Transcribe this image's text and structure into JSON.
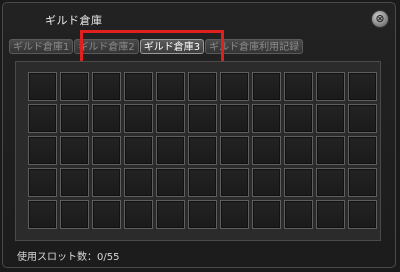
{
  "window": {
    "title": "ギルド倉庫",
    "close_symbol": "⊗"
  },
  "tabs": [
    {
      "label": "ギルド倉庫1",
      "active": false
    },
    {
      "label": "ギルド倉庫2",
      "active": false
    },
    {
      "label": "ギルド倉庫3",
      "active": true
    },
    {
      "label": "ギルド倉庫利用記録",
      "active": false
    }
  ],
  "highlight_color": "#e01f1f",
  "grid": {
    "columns": 11,
    "rows": 5
  },
  "footer": {
    "used_slots": "使用スロット数：0/55"
  }
}
